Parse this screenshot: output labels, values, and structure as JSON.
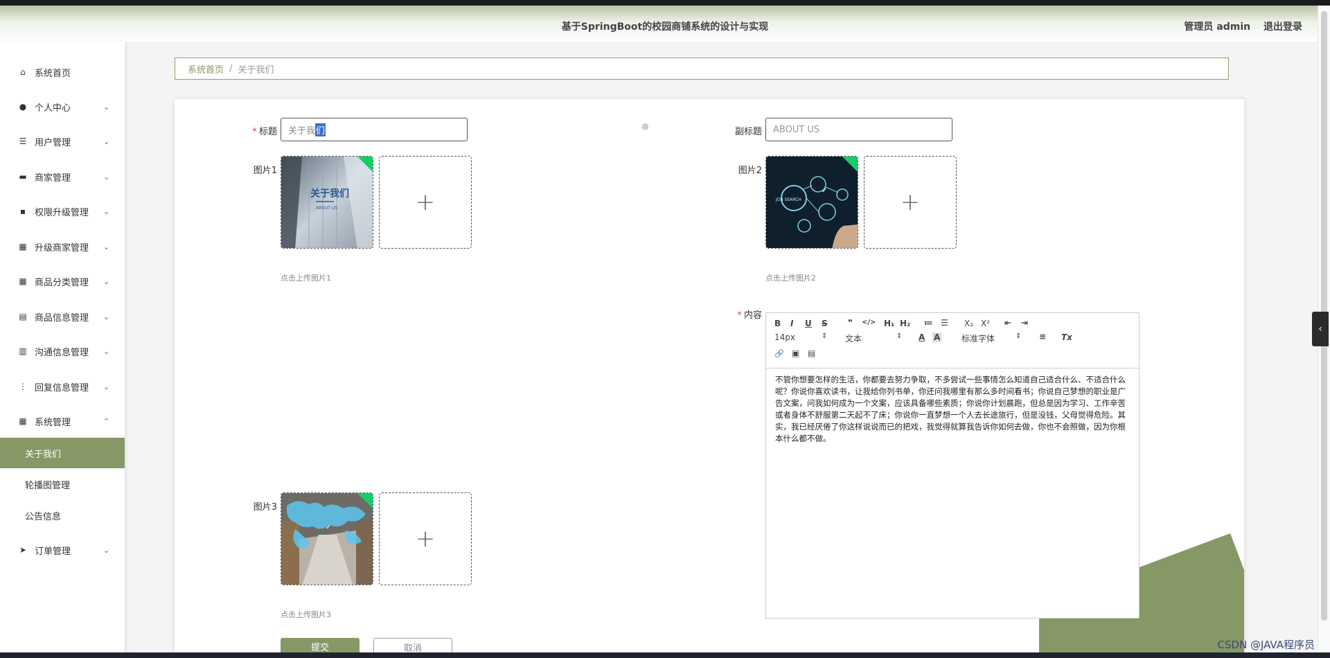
{
  "header": {
    "title": "基于SpringBoot的校园商铺系统的设计与实现",
    "user_label": "管理员 admin",
    "logout_label": "退出登录"
  },
  "sidebar": {
    "items": [
      {
        "label": "系统首页",
        "icon": "home-icon",
        "glyph": "⌂"
      },
      {
        "label": "个人中心",
        "icon": "user-icon",
        "glyph": "●"
      },
      {
        "label": "用户管理",
        "icon": "sliders-icon",
        "glyph": "☰"
      },
      {
        "label": "商家管理",
        "icon": "drive-icon",
        "glyph": "▬"
      },
      {
        "label": "权限升级管理",
        "icon": "chat-icon",
        "glyph": "▪"
      },
      {
        "label": "升级商家管理",
        "icon": "grid-icon",
        "glyph": "▦"
      },
      {
        "label": "商品分类管理",
        "icon": "grid-icon",
        "glyph": "▦"
      },
      {
        "label": "商品信息管理",
        "icon": "briefcase-icon",
        "glyph": "▤"
      },
      {
        "label": "沟通信息管理",
        "icon": "chart-icon",
        "glyph": "▥"
      },
      {
        "label": "回复信息管理",
        "icon": "dots-grid-icon",
        "glyph": "⋮"
      },
      {
        "label": "系统管理",
        "icon": "grid-icon",
        "glyph": "▦"
      },
      {
        "label": "订单管理",
        "icon": "send-icon",
        "glyph": "➤"
      }
    ],
    "sub_items": [
      "关于我们",
      "轮播图管理",
      "公告信息"
    ],
    "caret_down": "⌄",
    "caret_up": "⌃"
  },
  "breadcrumb": {
    "home": "系统首页",
    "separator": "/",
    "current": "关于我们"
  },
  "form": {
    "title_label": "标题",
    "title_value_pre": "关于我",
    "title_value_selected": "们",
    "subtitle_label": "副标题",
    "subtitle_value": "ABOUT US",
    "picture1_label": "图片1",
    "picture2_label": "图片2",
    "picture3_label": "图片3",
    "picture1_hint": "点击上传图片1",
    "picture2_hint": "点击上传图片2",
    "picture3_hint": "点击上传图片3",
    "picture1_overlay_title": "关于我们",
    "picture1_overlay_sub": "ABOUT US",
    "picture2_overlay_text": "JOB SEARCH",
    "add_symbol": "+",
    "content_label": "内容",
    "required_mark": "*",
    "clear_symbol": "⊗",
    "submit_label": "提交",
    "cancel_label": "取消"
  },
  "editor": {
    "font_size": "14px",
    "paragraph": "文本",
    "font_family": "标准字体",
    "buttons": {
      "bold": "B",
      "italic": "I",
      "underline": "U",
      "strike": "S",
      "quote": "❞",
      "code": "</>",
      "h1": "H₁",
      "h2": "H₂",
      "ordered_list": "≔",
      "bullet_list": "☰",
      "subscript": "X₂",
      "superscript": "X²",
      "outdent": "⇤",
      "indent": "⇥",
      "color": "A",
      "background": "A",
      "align": "≡",
      "clean": "Tx",
      "link": "🔗",
      "image": "▣",
      "video": "▤",
      "select_arrow": "⇕"
    },
    "content": "不管你想要怎样的生活，你都要去努力争取，不多尝试一些事情怎么知道自己适合什么、不适合什么呢？你说你喜欢读书，让我给你列书单，你还问我哪里有那么多时间看书；你说自己梦想的职业是广告文案，问我如何成为一个文案，应该具备哪些素质；你说你计划晨跑，但总是因为学习、工作辛苦或者身体不舒服第二天起不了床；你说你一直梦想一个人去长途旅行，但是没钱，父母觉得危险。其实，我已经厌倦了你这样说说而已的把戏，我觉得就算我告诉你如何去做，你也不会照做，因为你根本什么都不做。"
  },
  "watermark": "CSDN @JAVA程序员",
  "colors": {
    "accent": "#869866",
    "required": "#e04040",
    "upload_success": "#13ce66"
  }
}
